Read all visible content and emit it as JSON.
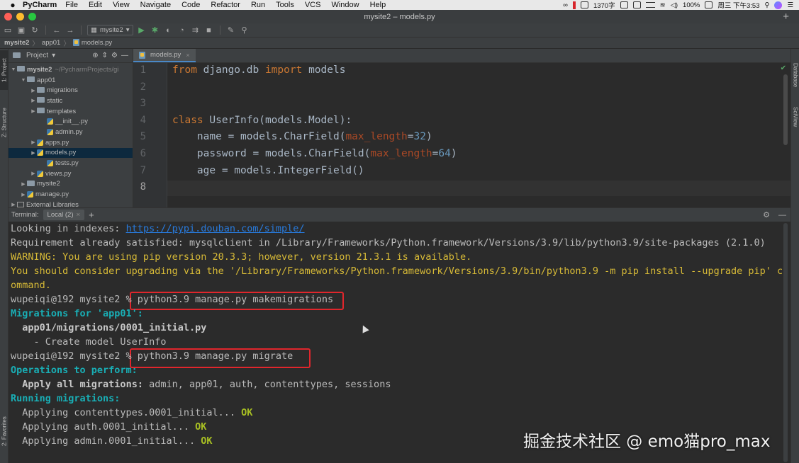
{
  "menubar": {
    "app_name": "PyCharm",
    "items": [
      "File",
      "Edit",
      "View",
      "Navigate",
      "Code",
      "Refactor",
      "Run",
      "Tools",
      "VCS",
      "Window",
      "Help"
    ],
    "status_text": "1370字",
    "battery": "100%",
    "clock": "周三 下午3:53"
  },
  "window": {
    "title": "mysite2 – models.py"
  },
  "toolbar": {
    "run_config": "mysite2"
  },
  "breadcrumb": [
    "mysite2",
    "app01",
    "models.py"
  ],
  "left_tabs": {
    "project": "1: Project",
    "structure": "Z: Structure",
    "favorites": "2: Favorites"
  },
  "right_tabs": {
    "database": "Database",
    "sciview": "SciView"
  },
  "project_panel": {
    "title": "Project",
    "tree": [
      {
        "label": "mysite2",
        "extra": "~/PycharmProjects/gi",
        "indent": 0,
        "arrow": "▼",
        "icon": "folder",
        "bold": true
      },
      {
        "label": "app01",
        "indent": 1,
        "arrow": "▼",
        "icon": "folder"
      },
      {
        "label": "migrations",
        "indent": 2,
        "arrow": "▶",
        "icon": "folder"
      },
      {
        "label": "static",
        "indent": 2,
        "arrow": "▶",
        "icon": "folder"
      },
      {
        "label": "templates",
        "indent": 2,
        "arrow": "▶",
        "icon": "folder"
      },
      {
        "label": "__init__.py",
        "indent": 3,
        "arrow": "",
        "icon": "py"
      },
      {
        "label": "admin.py",
        "indent": 3,
        "arrow": "",
        "icon": "py"
      },
      {
        "label": "apps.py",
        "indent": 2,
        "arrow": "▶",
        "icon": "py"
      },
      {
        "label": "models.py",
        "indent": 2,
        "arrow": "▶",
        "icon": "py",
        "selected": true
      },
      {
        "label": "tests.py",
        "indent": 3,
        "arrow": "",
        "icon": "py"
      },
      {
        "label": "views.py",
        "indent": 2,
        "arrow": "▶",
        "icon": "py"
      },
      {
        "label": "mysite2",
        "indent": 1,
        "arrow": "▶",
        "icon": "folder"
      },
      {
        "label": "manage.py",
        "indent": 1,
        "arrow": "▶",
        "icon": "py"
      },
      {
        "label": "External Libraries",
        "indent": 0,
        "arrow": "▶",
        "icon": "lib"
      }
    ]
  },
  "editor": {
    "tab_label": "models.py",
    "lines": [
      {
        "n": "1",
        "html": "<span class=\"kw\">from</span> django.db <span class=\"kw\">import</span> models"
      },
      {
        "n": "2",
        "html": ""
      },
      {
        "n": "3",
        "html": ""
      },
      {
        "n": "4",
        "html": "<span class=\"kw\">class</span> UserInfo(models.Model):"
      },
      {
        "n": "5",
        "html": "    name = models.CharField(<span class=\"param\">max_length</span>=<span class=\"num\">32</span>)"
      },
      {
        "n": "6",
        "html": "    password = models.CharField(<span class=\"param\">max_length</span>=<span class=\"num\">64</span>)"
      },
      {
        "n": "7",
        "html": "    age = models.IntegerField()"
      },
      {
        "n": "8",
        "html": ""
      }
    ]
  },
  "terminal": {
    "label": "Terminal:",
    "tab": "Local (2)",
    "lines": [
      {
        "html": "Looking in indexes: <span class=\"t-link\">https://pypi.douban.com/simple/</span>"
      },
      {
        "html": "Requirement already satisfied: mysqlclient in /Library/Frameworks/Python.framework/Versions/3.9/lib/python3.9/site-packages (2.1.0)"
      },
      {
        "html": "<span class=\"t-warn\">WARNING: You are using pip version 20.3.3; however, version 21.3.1 is available.</span>"
      },
      {
        "html": "<span class=\"t-warn\">You should consider upgrading via the '/Library/Frameworks/Python.framework/Versions/3.9/bin/python3.9 -m pip install --upgrade pip' c</span>"
      },
      {
        "html": "<span class=\"t-warn\">ommand.</span>"
      },
      {
        "html": "wupeiqi@192 mysite2 % python3.9 manage.py makemigrations"
      },
      {
        "html": "<span class=\"t-cyan\">Migrations for 'app01':</span>"
      },
      {
        "html": "  <span class=\"t-bold\">app01/migrations/0001_initial.py</span>"
      },
      {
        "html": "    - Create model UserInfo"
      },
      {
        "html": "wupeiqi@192 mysite2 % python3.9 manage.py migrate"
      },
      {
        "html": "<span class=\"t-cyan\">Operations to perform:</span>"
      },
      {
        "html": "  <span class=\"t-bold\">Apply all migrations:</span> admin, app01, auth, contenttypes, sessions"
      },
      {
        "html": "<span class=\"t-cyan\">Running migrations:</span>"
      },
      {
        "html": "  Applying contenttypes.0001_initial... <span class=\"t-ok\">OK</span>"
      },
      {
        "html": "  Applying auth.0001_initial... <span class=\"t-ok\">OK</span>"
      },
      {
        "html": "  Applying admin.0001_initial... <span class=\"t-ok\">OK</span>"
      }
    ]
  },
  "watermark": "掘金技术社区 @ emo猫pro_max",
  "colors": {
    "highlight": "#e0262c",
    "accent": "#4a88c7",
    "warning": "#d7ba37",
    "cyan": "#19aeb5",
    "ok": "#a8c023"
  }
}
